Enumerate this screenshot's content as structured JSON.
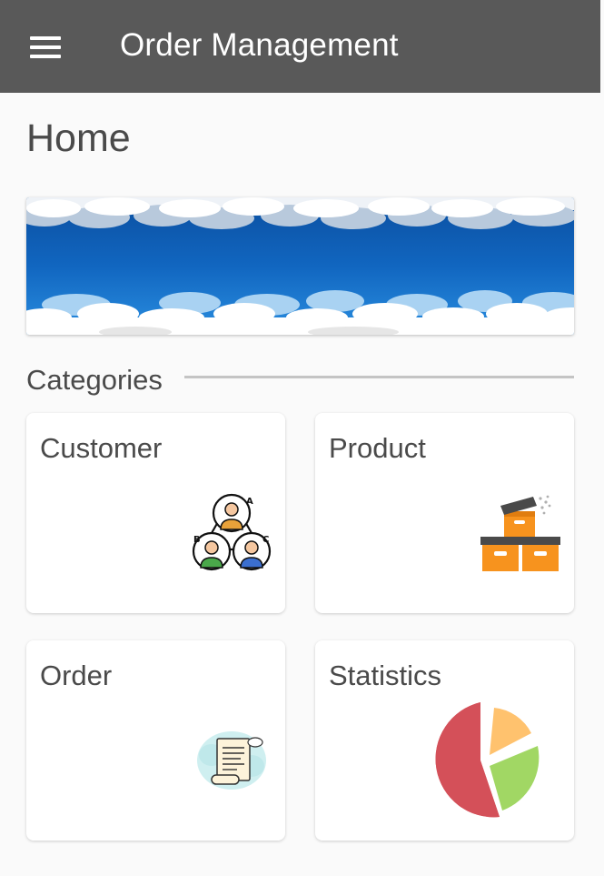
{
  "appbar": {
    "title": "Order Management",
    "background": "#595959",
    "menu_icon": "hamburger-menu-icon"
  },
  "page": {
    "title": "Home"
  },
  "banner": {
    "image": "sky-clouds-banner"
  },
  "categories": {
    "label": "Categories",
    "items": [
      {
        "label": "Customer",
        "icon": "customer-group-icon"
      },
      {
        "label": "Product",
        "icon": "product-boxes-icon"
      },
      {
        "label": "Order",
        "icon": "order-receipt-icon"
      },
      {
        "label": "Statistics",
        "icon": "pie-chart-icon"
      }
    ]
  },
  "colors": {
    "page_background": "#fafafa",
    "card_background": "#ffffff",
    "text": "#4a4a4a",
    "divider": "#c4c4c4"
  }
}
